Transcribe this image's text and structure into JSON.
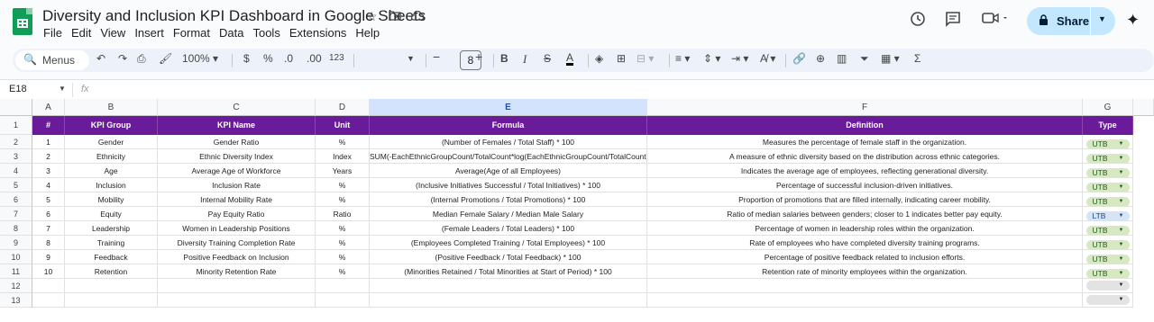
{
  "doc": {
    "title": "Diversity and Inclusion KPI Dashboard in Google Sheets",
    "menus": [
      "File",
      "Edit",
      "View",
      "Insert",
      "Format",
      "Data",
      "Tools",
      "Extensions",
      "Help"
    ],
    "share_label": "Share"
  },
  "toolbar": {
    "search_label": "Menus",
    "zoom": "100%",
    "currency": "$",
    "percent": "%",
    "dec_decrease": ".0",
    "dec_increase": ".00",
    "number_format": "123",
    "font_size": "8",
    "bold": "B",
    "italic": "I",
    "strikethrough": "S",
    "text_color": "A",
    "function": "Σ"
  },
  "formula_bar": {
    "cell_ref": "E18",
    "fx": "fx",
    "value": ""
  },
  "columns": [
    "A",
    "B",
    "C",
    "D",
    "E",
    "F",
    "G"
  ],
  "selected_column": "E",
  "row_numbers": [
    "1",
    "2",
    "3",
    "4",
    "5",
    "6",
    "7",
    "8",
    "9",
    "10",
    "11",
    "12",
    "13"
  ],
  "table": {
    "headers": [
      "#",
      "KPI Group",
      "KPI Name",
      "Unit",
      "Formula",
      "Definition",
      "Type"
    ],
    "rows": [
      {
        "num": "1",
        "group": "Gender",
        "name": "Gender Ratio",
        "unit": "%",
        "formula": "(Number of Females / Total Staff) * 100",
        "definition": "Measures the percentage of female staff in the organization.",
        "type": "UTB"
      },
      {
        "num": "2",
        "group": "Ethnicity",
        "name": "Ethnic Diversity Index",
        "unit": "Index",
        "formula": "SUM(-EachEthnicGroupCount/TotalCount*log(EachEthnicGroupCount/TotalCount))",
        "definition": "A measure of ethnic diversity based on the distribution across ethnic categories.",
        "type": "UTB"
      },
      {
        "num": "3",
        "group": "Age",
        "name": "Average Age of Workforce",
        "unit": "Years",
        "formula": "Average(Age of all Employees)",
        "definition": "Indicates the average age of employees, reflecting generational diversity.",
        "type": "UTB"
      },
      {
        "num": "4",
        "group": "Inclusion",
        "name": "Inclusion Rate",
        "unit": "%",
        "formula": "(Inclusive Initiatives Successful / Total Initiatives) * 100",
        "definition": "Percentage of successful inclusion-driven initiatives.",
        "type": "UTB"
      },
      {
        "num": "5",
        "group": "Mobility",
        "name": "Internal Mobility Rate",
        "unit": "%",
        "formula": "(Internal Promotions / Total Promotions) * 100",
        "definition": "Proportion of promotions that are filled internally, indicating career mobility.",
        "type": "UTB"
      },
      {
        "num": "6",
        "group": "Equity",
        "name": "Pay Equity Ratio",
        "unit": "Ratio",
        "formula": "Median Female Salary / Median Male Salary",
        "definition": "Ratio of median salaries between genders; closer to 1 indicates better pay equity.",
        "type": "LTB"
      },
      {
        "num": "7",
        "group": "Leadership",
        "name": "Women in Leadership Positions",
        "unit": "%",
        "formula": "(Female Leaders / Total Leaders) * 100",
        "definition": "Percentage of women in leadership roles within the organization.",
        "type": "UTB"
      },
      {
        "num": "8",
        "group": "Training",
        "name": "Diversity Training Completion Rate",
        "unit": "%",
        "formula": "(Employees Completed Training / Total Employees) * 100",
        "definition": "Rate of employees who have completed diversity training programs.",
        "type": "UTB"
      },
      {
        "num": "9",
        "group": "Feedback",
        "name": "Positive Feedback on Inclusion",
        "unit": "%",
        "formula": "(Positive Feedback / Total Feedback) * 100",
        "definition": "Percentage of positive feedback related to inclusion efforts.",
        "type": "UTB"
      },
      {
        "num": "10",
        "group": "Retention",
        "name": "Minority Retention Rate",
        "unit": "%",
        "formula": "(Minorities Retained / Total Minorities at Start of Period) * 100",
        "definition": "Retention rate of minority employees within the organization.",
        "type": "UTB"
      }
    ]
  },
  "colors": {
    "header_bg": "#6a1b9a",
    "utb_chip": "#d7e8c3",
    "ltb_chip": "#d6e4f5",
    "share_bg": "#c2e7ff"
  }
}
